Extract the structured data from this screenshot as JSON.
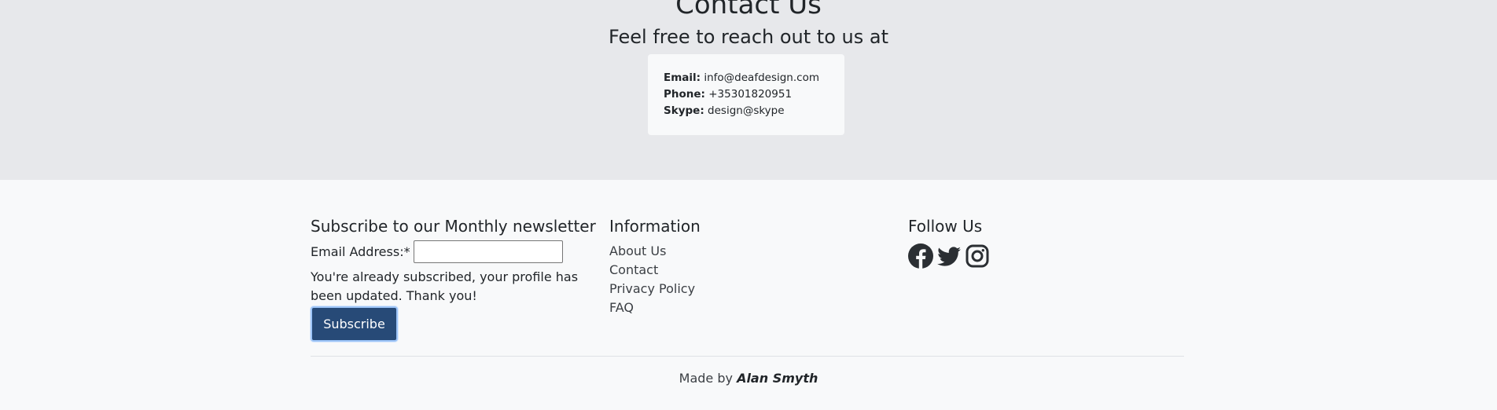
{
  "contact": {
    "title": "Contact Us",
    "subtitle": "Feel free to reach out to us at",
    "email_label": "Email:",
    "email_value": "info@deafdesign.com",
    "phone_label": "Phone:",
    "phone_value": "+35301820951",
    "skype_label": "Skype:",
    "skype_value": "design@skype"
  },
  "newsletter": {
    "heading": "Subscribe to our Monthly newsletter",
    "email_label": "Email Address:*",
    "email_value": "",
    "message": "You're already subscribed, your profile has been updated. Thank you!",
    "button_label": "Subscribe"
  },
  "information": {
    "heading": "Information",
    "links": [
      "About Us",
      "Contact",
      "Privacy Policy",
      "FAQ"
    ]
  },
  "follow": {
    "heading": "Follow Us",
    "icons": [
      "facebook-icon",
      "twitter-icon",
      "instagram-icon"
    ]
  },
  "footer": {
    "made_by_prefix": "Made by",
    "author": "Alan Smyth"
  },
  "colors": {
    "contact_bg": "#e7e8eb",
    "footer_bg": "#f8f9fa",
    "button_bg": "#274a77"
  }
}
